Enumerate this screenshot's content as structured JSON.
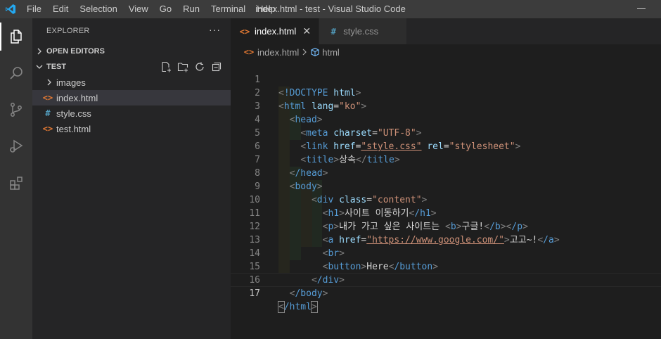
{
  "window": {
    "title": "index.html - test - Visual Studio Code",
    "menu": [
      "File",
      "Edit",
      "Selection",
      "View",
      "Go",
      "Run",
      "Terminal",
      "Help"
    ]
  },
  "activity_bar": {
    "items": [
      "explorer-icon",
      "search-icon",
      "source-control-icon",
      "run-debug-icon",
      "extensions-icon"
    ]
  },
  "sidebar": {
    "header": "EXPLORER",
    "more": "···",
    "open_editors": "OPEN EDITORS",
    "folder": "TEST",
    "items": [
      {
        "label": "images",
        "type": "folder"
      },
      {
        "label": "index.html",
        "type": "html"
      },
      {
        "label": "style.css",
        "type": "css"
      },
      {
        "label": "test.html",
        "type": "html"
      }
    ]
  },
  "tabs": [
    {
      "label": "index.html",
      "icon": "<>",
      "active": true
    },
    {
      "label": "style.css",
      "icon": "#",
      "active": false
    }
  ],
  "breadcrumb": {
    "file": "index.html",
    "symbol": "html"
  },
  "editor": {
    "current_line": 17,
    "lines": [
      {
        "n": "1"
      },
      {
        "n": "2"
      },
      {
        "n": "3"
      },
      {
        "n": "4"
      },
      {
        "n": "5"
      },
      {
        "n": "6"
      },
      {
        "n": "7"
      },
      {
        "n": "8"
      },
      {
        "n": "9"
      },
      {
        "n": "10"
      },
      {
        "n": "11"
      },
      {
        "n": "12"
      },
      {
        "n": "13"
      },
      {
        "n": "14"
      },
      {
        "n": "15"
      },
      {
        "n": "16"
      },
      {
        "n": "17"
      }
    ],
    "code": {
      "l1_doctype": "!DOCTYPE",
      "l1_html": "html",
      "l2_tag": "html",
      "l2_attr": "lang",
      "l2_val": "\"ko\"",
      "l3_tag": "head",
      "l4_tag": "meta",
      "l4_attr": "charset",
      "l4_val": "\"UTF-8\"",
      "l5_tag": "link",
      "l5_attr1": "href",
      "l5_val1": "\"style.css\"",
      "l5_attr2": "rel",
      "l5_val2": "\"stylesheet\"",
      "l6_tag": "title",
      "l6_text": "상속",
      "l7_tag": "/head",
      "l8_tag": "body",
      "l9_tag": "div",
      "l9_attr": "class",
      "l9_val": "\"content\"",
      "l10_tag": "h1",
      "l10_text": "사이트 이동하기",
      "l10_close": "/h1",
      "l11_tag": "p",
      "l11_text": "내가 가고 싶은 사이트는 ",
      "l11_btag": "b",
      "l11_btext": "구글!",
      "l11_bclose": "/b",
      "l11_close": "/p",
      "l12_tag": "a",
      "l12_attr": "href",
      "l12_val": "\"https://www.google.com/\"",
      "l12_text": "고고~!",
      "l12_close": "/a",
      "l13_tag": "br",
      "l14_tag": "button",
      "l14_text": "Here",
      "l14_close": "/button",
      "l15_tag": "/div",
      "l16_tag": "/body",
      "l17_tag": "/html"
    }
  }
}
